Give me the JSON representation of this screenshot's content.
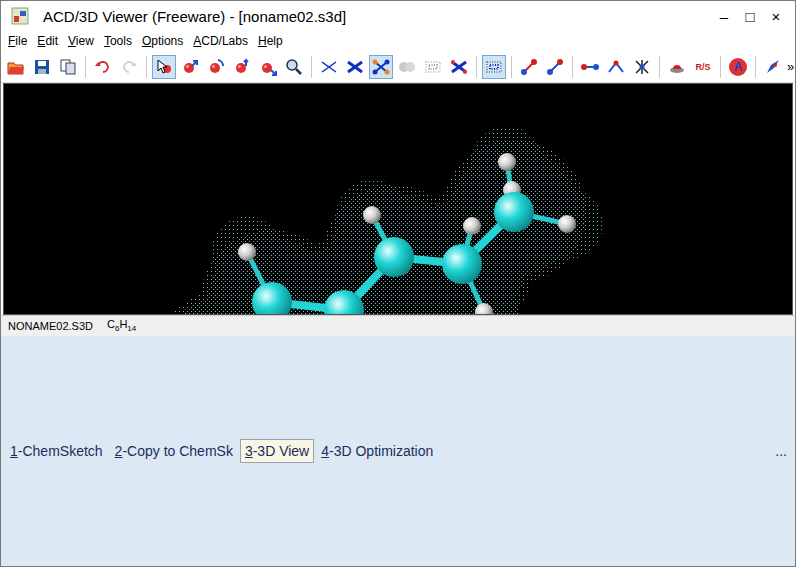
{
  "window": {
    "title": "ACD/3D Viewer (Freeware) - [noname02.s3d]",
    "controls": [
      "–",
      "□",
      "×"
    ]
  },
  "menu": [
    {
      "label": "File",
      "underline": "F"
    },
    {
      "label": "Edit",
      "underline": "E"
    },
    {
      "label": "View",
      "underline": "V"
    },
    {
      "label": "Tools",
      "underline": "T"
    },
    {
      "label": "Options",
      "underline": "O"
    },
    {
      "label": "ACD/Labs",
      "underline": "A"
    },
    {
      "label": "Help",
      "underline": "H"
    }
  ],
  "toolbar": {
    "items": [
      {
        "kind": "button",
        "pressed": false,
        "disabled": false
      },
      {
        "kind": "button",
        "pressed": false,
        "disabled": false
      },
      {
        "kind": "button",
        "pressed": false,
        "disabled": false
      },
      {
        "kind": "separator"
      },
      {
        "kind": "button",
        "pressed": false,
        "disabled": false
      },
      {
        "kind": "button",
        "pressed": false,
        "disabled": true
      },
      {
        "kind": "separator"
      },
      {
        "kind": "button",
        "pressed": true,
        "disabled": false
      },
      {
        "kind": "button",
        "pressed": false,
        "disabled": false
      },
      {
        "kind": "button",
        "pressed": false,
        "disabled": false
      },
      {
        "kind": "button",
        "pressed": false,
        "disabled": false
      },
      {
        "kind": "button",
        "pressed": false,
        "disabled": false
      },
      {
        "kind": "button",
        "pressed": false,
        "disabled": false
      },
      {
        "kind": "separator"
      },
      {
        "kind": "button",
        "pressed": false,
        "disabled": false
      },
      {
        "kind": "button",
        "pressed": false,
        "disabled": false
      },
      {
        "kind": "button",
        "pressed": true,
        "disabled": false
      },
      {
        "kind": "button",
        "pressed": false,
        "disabled": true
      },
      {
        "kind": "button",
        "pressed": false,
        "disabled": true
      },
      {
        "kind": "button",
        "pressed": false,
        "disabled": false
      },
      {
        "kind": "separator"
      },
      {
        "kind": "button",
        "pressed": true,
        "disabled": false
      },
      {
        "kind": "separator"
      },
      {
        "kind": "button",
        "pressed": false,
        "disabled": false
      },
      {
        "kind": "button",
        "pressed": false,
        "disabled": false
      },
      {
        "kind": "separator"
      },
      {
        "kind": "button",
        "pressed": false,
        "disabled": false
      },
      {
        "kind": "button",
        "pressed": false,
        "disabled": false
      },
      {
        "kind": "button",
        "pressed": false,
        "disabled": false
      },
      {
        "kind": "separator"
      },
      {
        "kind": "button",
        "pressed": false,
        "disabled": false
      },
      {
        "kind": "button",
        "pressed": false,
        "disabled": false,
        "glyph": "R/S"
      },
      {
        "kind": "separator"
      },
      {
        "kind": "button",
        "pressed": false,
        "disabled": false,
        "glyph": "A"
      },
      {
        "kind": "separator"
      },
      {
        "kind": "button",
        "pressed": false,
        "disabled": false
      }
    ],
    "overflow": "»"
  },
  "status_bar": {
    "file": "NONAME02.S3D",
    "formula": [
      {
        "text": "C",
        "sub": false
      },
      {
        "text": "6",
        "sub": true
      },
      {
        "text": "H",
        "sub": false
      },
      {
        "text": "14",
        "sub": true
      }
    ]
  },
  "tabs": [
    {
      "label": "1-ChemSketch",
      "underline": "1",
      "selected": false
    },
    {
      "label": "2-Copy to ChemSk",
      "underline": "2",
      "selected": false
    },
    {
      "label": "3-3D View",
      "underline": "3",
      "selected": true
    },
    {
      "label": "4-3D Optimization",
      "underline": "4",
      "selected": false
    }
  ],
  "tabs_more": "..."
}
